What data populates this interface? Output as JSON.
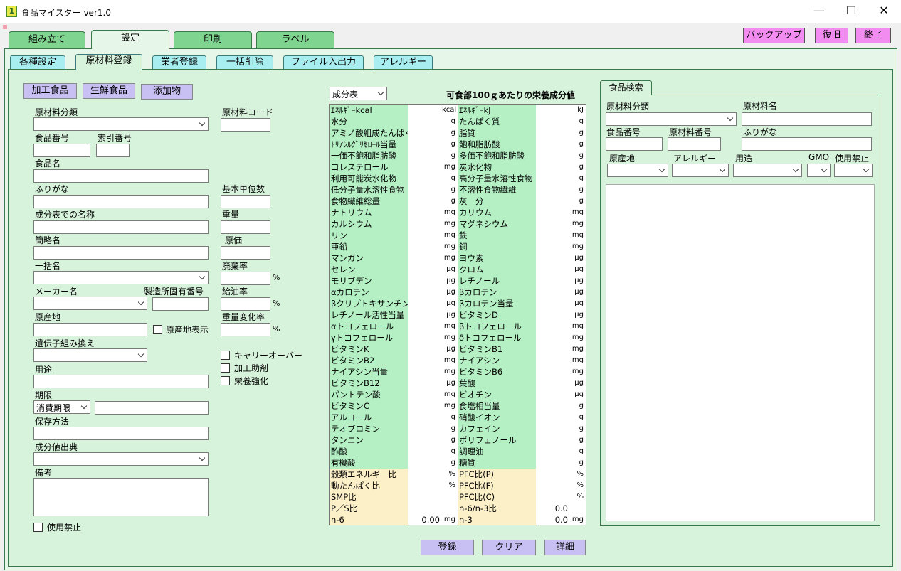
{
  "window": {
    "title": "食品マイスター ver1.0",
    "icon_text": "1",
    "min": "—",
    "max": "☐",
    "close": "✕"
  },
  "main_tabs": [
    "組み立て",
    "設定",
    "印刷",
    "ラベル"
  ],
  "top_buttons": {
    "backup": "バックアップ",
    "restore": "復旧",
    "exit": "終了"
  },
  "sub_tabs": [
    "各種設定",
    "原材料登録",
    "業者登録",
    "一括削除",
    "ファイル入出力",
    "アレルギー"
  ],
  "type_buttons": [
    "加工食品",
    "生鮮食品",
    "添加物"
  ],
  "form": {
    "category": "原材料分類",
    "code": "原材料コード",
    "food_no": "食品番号",
    "index_no": "索引番号",
    "food_name": "食品名",
    "furigana": "ふりがな",
    "base_unit": "基本単位数",
    "component_name": "成分表での名称",
    "weight": "重量",
    "short_name": "簡略名",
    "cost": "原価",
    "bulk_name": "一括名",
    "waste_rate": "廃棄率",
    "maker": "メーカー名",
    "factory_no": "製造所固有番号",
    "oil_rate": "給油率",
    "origin": "原産地",
    "origin_display": "原産地表示",
    "weight_change": "重量変化率",
    "gm": "遺伝子組み換え",
    "carryover": "キャリーオーバー",
    "processing_aid": "加工助剤",
    "fortify": "栄養強化",
    "usage": "用途",
    "term": "期限",
    "term_select": "消費期限",
    "storage": "保存方法",
    "source": "成分値出典",
    "notes": "備考",
    "prohibited": "使用禁止",
    "percent": "%"
  },
  "nutrition": {
    "selector": "成分表",
    "heading": "可食部100ｇあたりの栄養成分値",
    "rows": [
      {
        "n1": "ｴﾈﾙｷﾞｰkcal",
        "u1": "kcal",
        "n2": "ｴﾈﾙｷﾞｰkJ",
        "u2": "kJ"
      },
      {
        "n1": "水分",
        "u1": "g",
        "n2": "たんぱく質",
        "u2": "g"
      },
      {
        "n1": "アミノ酸組成たんぱく",
        "u1": "g",
        "n2": "脂質",
        "u2": "g"
      },
      {
        "n1": "ﾄﾘｱｼﾙｸﾞﾘｾﾛｰﾙ当量",
        "u1": "g",
        "n2": "飽和脂肪酸",
        "u2": "g"
      },
      {
        "n1": "一価不飽和脂肪酸",
        "u1": "g",
        "n2": "多価不飽和脂肪酸",
        "u2": "g"
      },
      {
        "n1": "コレステロール",
        "u1": "mg",
        "n2": "炭水化物",
        "u2": "g"
      },
      {
        "n1": "利用可能炭水化物",
        "u1": "g",
        "n2": "高分子量水溶性食物",
        "u2": "g"
      },
      {
        "n1": "低分子量水溶性食物",
        "u1": "g",
        "n2": "不溶性食物繊維",
        "u2": "g"
      },
      {
        "n1": "食物繊維総量",
        "u1": "g",
        "n2": "灰　分",
        "u2": "g"
      },
      {
        "n1": "ナトリウム",
        "u1": "mg",
        "n2": "カリウム",
        "u2": "mg"
      },
      {
        "n1": "カルシウム",
        "u1": "mg",
        "n2": "マグネシウム",
        "u2": "mg"
      },
      {
        "n1": "リン",
        "u1": "mg",
        "n2": "鉄",
        "u2": "mg"
      },
      {
        "n1": "亜鉛",
        "u1": "mg",
        "n2": "銅",
        "u2": "mg"
      },
      {
        "n1": "マンガン",
        "u1": "mg",
        "n2": "ヨウ素",
        "u2": "μg"
      },
      {
        "n1": "セレン",
        "u1": "μg",
        "n2": "クロム",
        "u2": "μg"
      },
      {
        "n1": "モリブデン",
        "u1": "μg",
        "n2": "レチノール",
        "u2": "μg"
      },
      {
        "n1": "αカロテン",
        "u1": "μg",
        "n2": "βカロテン",
        "u2": "μg"
      },
      {
        "n1": "βクリプトキサンチン",
        "u1": "μg",
        "n2": "βカロテン当量",
        "u2": "μg"
      },
      {
        "n1": "レチノール活性当量",
        "u1": "μg",
        "n2": "ビタミンD",
        "u2": "μg"
      },
      {
        "n1": "αトコフェロール",
        "u1": "mg",
        "n2": "βトコフェロール",
        "u2": "mg"
      },
      {
        "n1": "γトコフェロール",
        "u1": "mg",
        "n2": "δトコフェロール",
        "u2": "mg"
      },
      {
        "n1": "ビタミンK",
        "u1": "μg",
        "n2": "ビタミンB1",
        "u2": "mg"
      },
      {
        "n1": "ビタミンB2",
        "u1": "mg",
        "n2": "ナイアシン",
        "u2": "mg"
      },
      {
        "n1": "ナイアシン当量",
        "u1": "mg",
        "n2": "ビタミンB6",
        "u2": "mg"
      },
      {
        "n1": "ビタミンB12",
        "u1": "μg",
        "n2": "葉酸",
        "u2": "μg"
      },
      {
        "n1": "パントテン酸",
        "u1": "mg",
        "n2": "ビオチン",
        "u2": "μg"
      },
      {
        "n1": "ビタミンC",
        "u1": "mg",
        "n2": "食塩相当量",
        "u2": "g"
      },
      {
        "n1": "アルコール",
        "u1": "g",
        "n2": "硝酸イオン",
        "u2": "g"
      },
      {
        "n1": "テオブロミン",
        "u1": "g",
        "n2": "カフェイン",
        "u2": "g"
      },
      {
        "n1": "タンニン",
        "u1": "g",
        "n2": "ポリフェノール",
        "u2": "g"
      },
      {
        "n1": "酢酸",
        "u1": "g",
        "n2": "調理油",
        "u2": "g"
      },
      {
        "n1": "有機酸",
        "u1": "g",
        "n2": "糖質",
        "u2": "g"
      }
    ],
    "extra_rows": [
      {
        "n1": "穀類エネルギー比",
        "u1": "%",
        "n2": "PFC比(P)",
        "u2": "%"
      },
      {
        "n1": "動たんぱく比",
        "u1": "%",
        "n2": "PFC比(F)",
        "u2": "%"
      },
      {
        "n1": "SMP比",
        "u1": "",
        "n2": "PFC比(C)",
        "u2": "%"
      },
      {
        "n1": "P／S比",
        "u1": "",
        "n2": "n-6/n-3比",
        "v2": "0.0",
        "u2": ""
      },
      {
        "n1": "n-6",
        "v1": "0.00",
        "u1": "mg",
        "n2": "n-3",
        "v2": "0.0",
        "u2": "mg"
      }
    ]
  },
  "search": {
    "tab": "食品検索",
    "category": "原材料分類",
    "name": "原材料名",
    "food_no": "食品番号",
    "material_no": "原材料番号",
    "furigana": "ふりがな",
    "origin": "原産地",
    "allergy": "アレルギー",
    "usage": "用途",
    "gmo": "GMO",
    "prohibited": "使用禁止"
  },
  "bottom_buttons": {
    "register": "登録",
    "clear": "クリア",
    "detail": "詳細"
  }
}
